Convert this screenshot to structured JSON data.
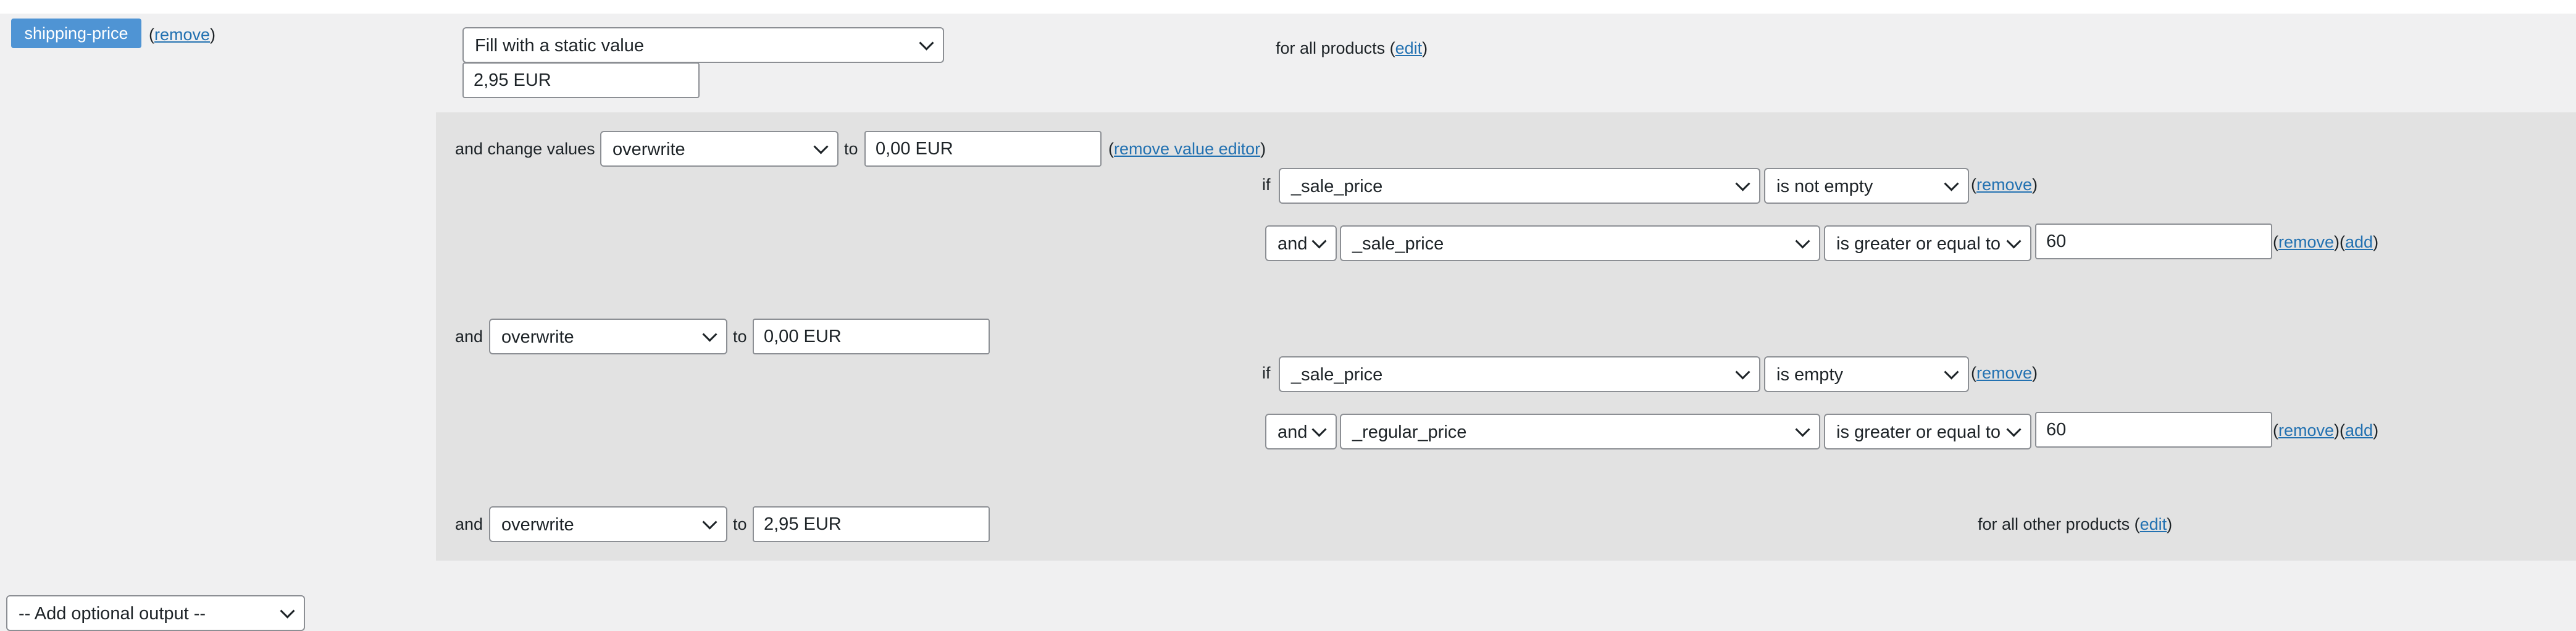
{
  "output": {
    "tag": "shipping-price",
    "remove_label": "remove",
    "fill_select": "Fill with a static value",
    "static_value": "2,95 EUR",
    "for_all_products": "for all products",
    "edit_label": "edit"
  },
  "rules": [
    {
      "prefix": "and change values",
      "action": "overwrite",
      "to_label": "to",
      "value": "0,00 EUR",
      "remove_value_editor": "remove value editor",
      "conditions": [
        {
          "lead": "if",
          "field": "_sale_price",
          "operator": "is not empty",
          "value": "",
          "remove": "remove"
        },
        {
          "lead": "and",
          "field": "_sale_price",
          "operator": "is greater or equal to",
          "value": "60",
          "remove": "remove",
          "add": "add"
        }
      ]
    },
    {
      "prefix": "and",
      "action": "overwrite",
      "to_label": "to",
      "value": "0,00 EUR",
      "conditions": [
        {
          "lead": "if",
          "field": "_sale_price",
          "operator": "is empty",
          "value": "",
          "remove": "remove"
        },
        {
          "lead": "and",
          "field": "_regular_price",
          "operator": "is greater or equal to",
          "value": "60",
          "remove": "remove",
          "add": "add"
        }
      ]
    },
    {
      "prefix": "and",
      "action": "overwrite",
      "to_label": "to",
      "value": "2,95 EUR",
      "for_all_other_products": "for all other products",
      "edit_label": "edit"
    }
  ],
  "add_optional_output": "-- Add optional output --"
}
